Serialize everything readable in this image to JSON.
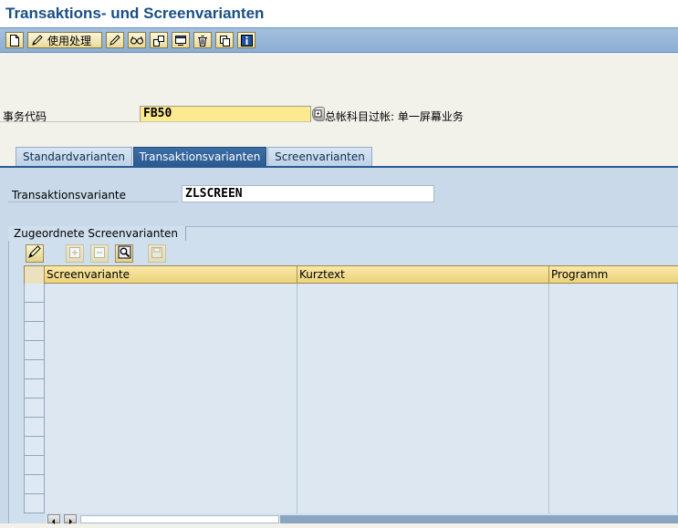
{
  "window": {
    "title": "Transaktions- und Screenvarianten"
  },
  "toolbar": {
    "buttons": [
      {
        "icon": "new-document-icon"
      },
      {
        "icon": "pencil-icon",
        "label": "使用处理"
      },
      {
        "icon": "edit-pencil-icon"
      },
      {
        "icon": "glasses-display-icon"
      },
      {
        "icon": "copy-variant-icon"
      },
      {
        "icon": "screen-icon"
      },
      {
        "icon": "trash-icon"
      },
      {
        "icon": "duplicate-icon"
      },
      {
        "icon": "info-icon"
      }
    ]
  },
  "transaction": {
    "label": "事务代码",
    "value": "FB50",
    "description": "总帐科目过帐: 单一屏幕业务"
  },
  "tabs": [
    {
      "label": "Standardvarianten",
      "active": false
    },
    {
      "label": "Transaktionsvarianten",
      "active": true
    },
    {
      "label": "Screenvarianten",
      "active": false
    }
  ],
  "transaction_variant": {
    "label": "Transaktionsvariante",
    "value": "ZLSCREEN"
  },
  "screen_variants_group": {
    "title": "Zugeordnete Screenvarianten",
    "toolbar_icons": [
      "edit-pencil-icon",
      "insert-row-icon",
      "delete-row-icon",
      "find-icon",
      "save-icon"
    ],
    "columns": [
      "Screenvariante",
      "Kurztext",
      "Programm"
    ],
    "rows": [
      [
        "",
        "",
        ""
      ],
      [
        "",
        "",
        ""
      ],
      [
        "",
        "",
        ""
      ],
      [
        "",
        "",
        ""
      ],
      [
        "",
        "",
        ""
      ],
      [
        "",
        "",
        ""
      ],
      [
        "",
        "",
        ""
      ],
      [
        "",
        "",
        ""
      ],
      [
        "",
        "",
        ""
      ],
      [
        "",
        "",
        ""
      ],
      [
        "",
        "",
        ""
      ],
      [
        "",
        "",
        ""
      ]
    ]
  },
  "colors": {
    "toolbar": "#9ab8da",
    "title": "#1a4f86",
    "input_highlight": "#fde98f",
    "active_tab": "#2b5a90",
    "panel": "#c9d9e9",
    "grid_header": "#f3dd8c"
  }
}
